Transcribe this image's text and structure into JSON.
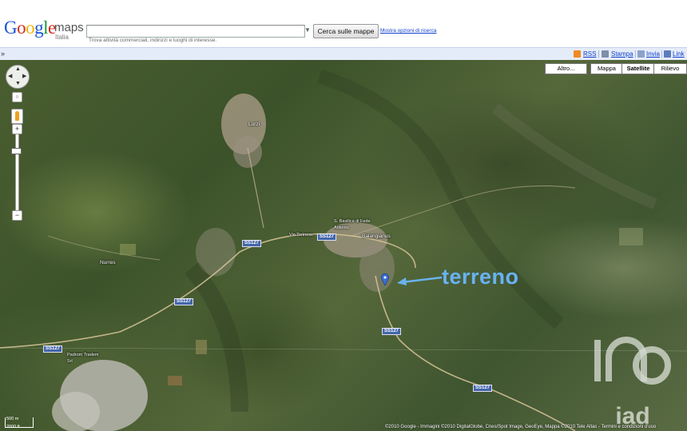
{
  "header": {
    "logo_text": "Google",
    "logo_product": "maps",
    "logo_country": "Italia",
    "search_value": "",
    "search_hint": "Trova attività commerciali, indirizzi e luoghi di interesse.",
    "search_button": "Cerca sulle mappe",
    "advanced_link": "Mostra opzioni di ricerca"
  },
  "toolbar": {
    "collapse": "»",
    "items": [
      {
        "label": "RSS",
        "icon": "rss-icon",
        "color": "#f08a24"
      },
      {
        "label": "Stampa",
        "icon": "print-icon",
        "color": "#7f8fa8"
      },
      {
        "label": "Invia",
        "icon": "email-icon",
        "color": "#8aa2c8"
      },
      {
        "label": "Link",
        "icon": "link-icon",
        "color": "#5a7cc0"
      }
    ]
  },
  "map": {
    "type_buttons": {
      "altro": "Altro...",
      "mappa": "Mappa",
      "satellite": "Satellite",
      "rilievo": "Rilievo",
      "active": "Satellite"
    },
    "road_labels": [
      "SS127",
      "SS127",
      "SS127",
      "SS127",
      "SS127",
      "SS127"
    ],
    "place_labels": [
      "Lurzi",
      "Balangianus",
      "S. Basilica di Fede Antonio",
      "Nurres",
      "Padrom Tradem Srl",
      "Via Torinese"
    ],
    "annotation": "terreno",
    "annotation_color": "#6ab2ec",
    "marker_icon": "map-pin-icon",
    "scale": {
      "label_top": "500 m",
      "label_bottom": "2000 ft"
    },
    "copyright": "©2010 Google - Immagini ©2010 DigitalGlobe, Cnes/Spot Image, GeoEye, Mappa ©2010 Tele Atlas - Termini e condizioni d'uso",
    "watermark_text": "iad"
  }
}
